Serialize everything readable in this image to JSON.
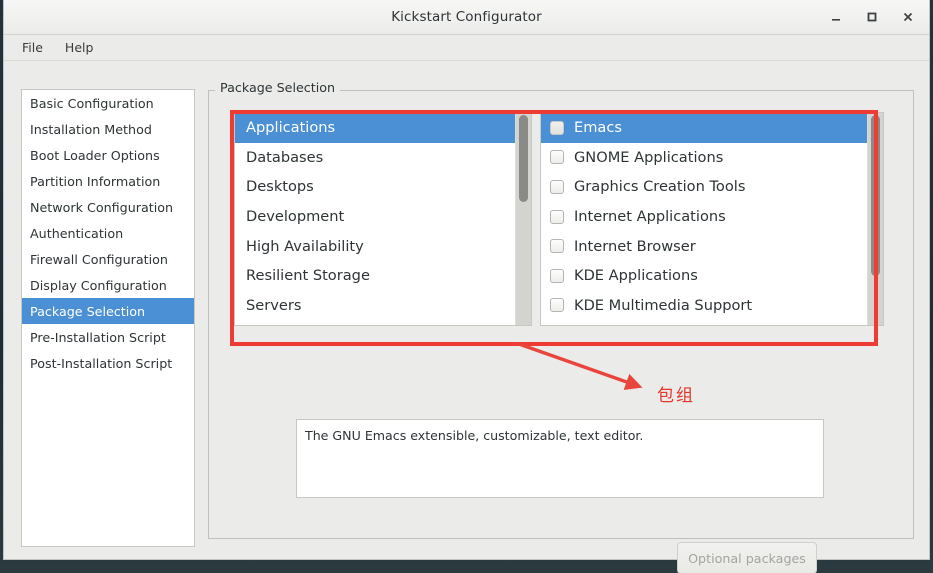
{
  "window": {
    "title": "Kickstart Configurator",
    "controls": {
      "minimize": "minimize-icon",
      "maximize": "maximize-icon",
      "close": "close-icon"
    }
  },
  "menubar": {
    "items": [
      {
        "label": "File"
      },
      {
        "label": "Help"
      }
    ]
  },
  "sidebar": {
    "items": [
      {
        "label": "Basic Configuration",
        "selected": false
      },
      {
        "label": "Installation Method",
        "selected": false
      },
      {
        "label": "Boot Loader Options",
        "selected": false
      },
      {
        "label": "Partition Information",
        "selected": false
      },
      {
        "label": "Network Configuration",
        "selected": false
      },
      {
        "label": "Authentication",
        "selected": false
      },
      {
        "label": "Firewall Configuration",
        "selected": false
      },
      {
        "label": "Display Configuration",
        "selected": false
      },
      {
        "label": "Package Selection",
        "selected": true
      },
      {
        "label": "Pre-Installation Script",
        "selected": false
      },
      {
        "label": "Post-Installation Script",
        "selected": false
      }
    ]
  },
  "main": {
    "group_title": "Package Selection",
    "group_list": {
      "items": [
        {
          "label": "Applications",
          "selected": true
        },
        {
          "label": "Databases",
          "selected": false
        },
        {
          "label": "Desktops",
          "selected": false
        },
        {
          "label": "Development",
          "selected": false
        },
        {
          "label": "High Availability",
          "selected": false
        },
        {
          "label": "Resilient Storage",
          "selected": false
        },
        {
          "label": "Servers",
          "selected": false
        }
      ],
      "scroll_thumb_top_pct": 1,
      "scroll_thumb_height_pct": 41
    },
    "package_list": {
      "items": [
        {
          "label": "Emacs",
          "checked": false,
          "selected": true
        },
        {
          "label": "GNOME Applications",
          "checked": false,
          "selected": false
        },
        {
          "label": "Graphics Creation Tools",
          "checked": false,
          "selected": false
        },
        {
          "label": "Internet Applications",
          "checked": false,
          "selected": false
        },
        {
          "label": "Internet Browser",
          "checked": false,
          "selected": false
        },
        {
          "label": "KDE Applications",
          "checked": false,
          "selected": false
        },
        {
          "label": "KDE Multimedia Support",
          "checked": false,
          "selected": false
        }
      ],
      "scroll_thumb_top_pct": 1,
      "scroll_thumb_height_pct": 76
    },
    "description": "The GNU Emacs extensible, customizable, text editor.",
    "optional_packages_button": "Optional packages"
  },
  "annotations": {
    "label": "包组",
    "highlight_color": "#ee3b33",
    "arrow_color": "#e8453c"
  }
}
